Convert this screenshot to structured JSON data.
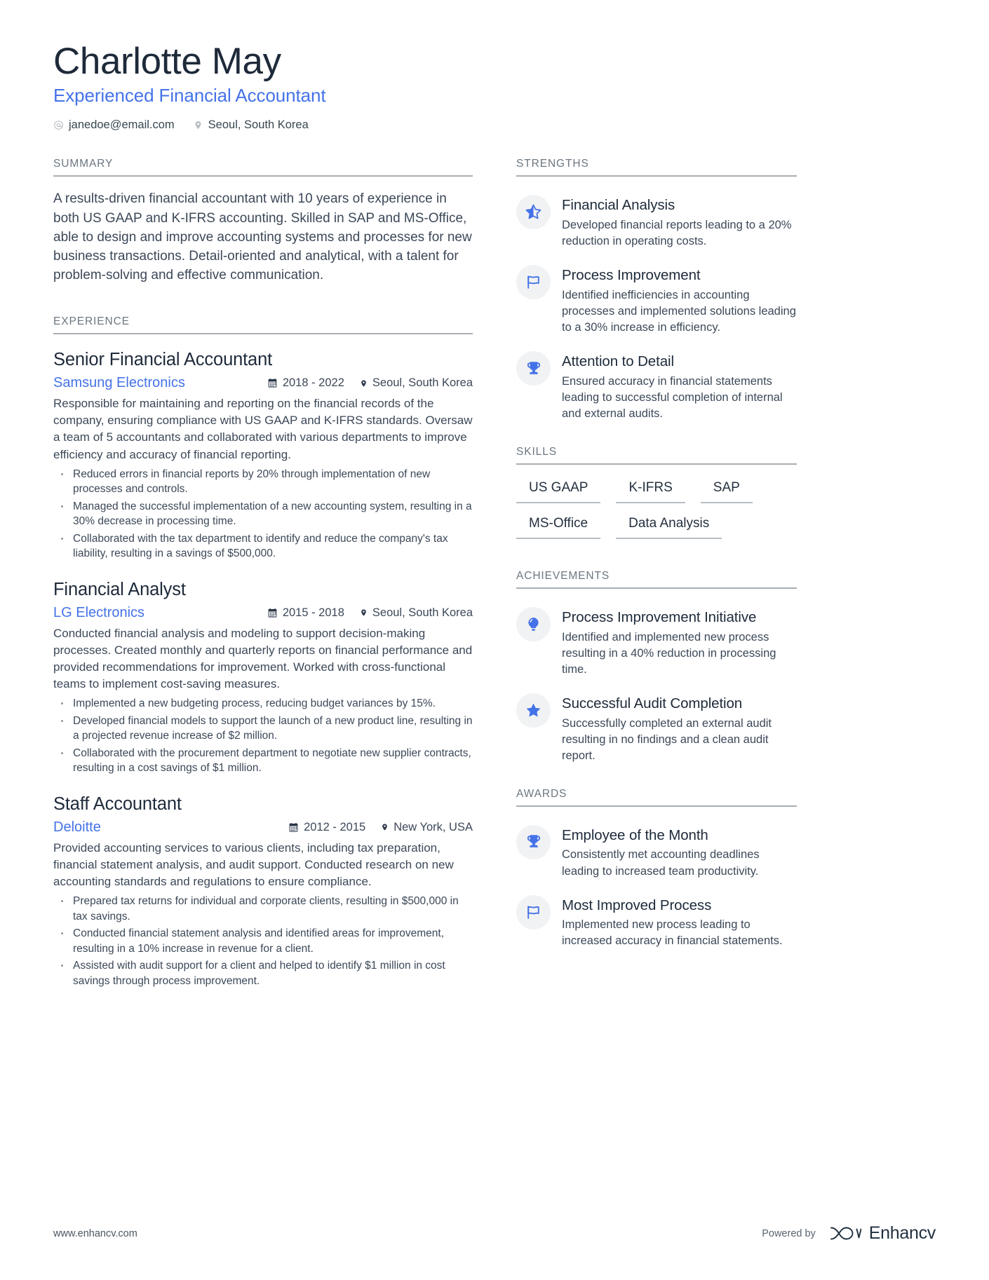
{
  "header": {
    "name": "Charlotte May",
    "role": "Experienced Financial Accountant",
    "contacts": [
      {
        "icon": "at-sign-icon",
        "text": "janedoe@email.com"
      },
      {
        "icon": "location-pin-icon",
        "text": "Seoul, South Korea"
      }
    ]
  },
  "sections": {
    "summary_title": "SUMMARY",
    "experience_title": "EXPERIENCE",
    "strengths_title": "STRENGTHS",
    "skills_title": "SKILLS",
    "achievements_title": "ACHIEVEMENTS",
    "awards_title": "AWARDS"
  },
  "summary": {
    "text": "A results-driven financial accountant with 10 years of experience in both US GAAP and K-IFRS accounting. Skilled in SAP and MS-Office, able to design and improve accounting systems and processes for new business transactions. Detail-oriented and analytical, with a talent for problem-solving and effective communication."
  },
  "experience": [
    {
      "title": "Senior Financial Accountant",
      "company": "Samsung Electronics",
      "dates": "2018 - 2022",
      "location": "Seoul, South Korea",
      "description": "Responsible for maintaining and reporting on the financial records of the company, ensuring compliance with US GAAP and K-IFRS standards. Oversaw a team of 5 accountants and collaborated with various departments to improve efficiency and accuracy of financial reporting.",
      "bullets": [
        "Reduced errors in financial reports by 20% through implementation of new processes and controls.",
        "Managed the successful implementation of a new accounting system, resulting in a 30% decrease in processing time.",
        "Collaborated with the tax department to identify and reduce the company's tax liability, resulting in a savings of $500,000."
      ]
    },
    {
      "title": "Financial Analyst",
      "company": "LG Electronics",
      "dates": "2015 - 2018",
      "location": "Seoul, South Korea",
      "description": "Conducted financial analysis and modeling to support decision-making processes. Created monthly and quarterly reports on financial performance and provided recommendations for improvement. Worked with cross-functional teams to implement cost-saving measures.",
      "bullets": [
        "Implemented a new budgeting process, reducing budget variances by 15%.",
        "Developed financial models to support the launch of a new product line, resulting in a projected revenue increase of $2 million.",
        "Collaborated with the procurement department to negotiate new supplier contracts, resulting in a cost savings of $1 million."
      ]
    },
    {
      "title": "Staff Accountant",
      "company": "Deloitte",
      "dates": "2012 - 2015",
      "location": "New York, USA",
      "description": "Provided accounting services to various clients, including tax preparation, financial statement analysis, and audit support. Conducted research on new accounting standards and regulations to ensure compliance.",
      "bullets": [
        "Prepared tax returns for individual and corporate clients, resulting in $500,000 in tax savings.",
        "Conducted financial statement analysis and identified areas for improvement, resulting in a 10% increase in revenue for a client.",
        "Assisted with audit support for a client and helped to identify $1 million in cost savings through process improvement."
      ]
    }
  ],
  "strengths": [
    {
      "icon": "half-star-icon",
      "title": "Financial Analysis",
      "description": "Developed financial reports leading to a 20% reduction in operating costs."
    },
    {
      "icon": "flag-outline-icon",
      "title": "Process Improvement",
      "description": "Identified inefficiencies in accounting processes and implemented solutions leading to a 30% increase in efficiency."
    },
    {
      "icon": "trophy-icon",
      "title": "Attention to Detail",
      "description": "Ensured accuracy in financial statements leading to successful completion of internal and external audits."
    }
  ],
  "skills": [
    "US GAAP",
    "K-IFRS",
    "SAP",
    "MS-Office",
    "Data Analysis"
  ],
  "achievements": [
    {
      "icon": "lightbulb-icon",
      "title": "Process Improvement Initiative",
      "description": "Identified and implemented new process resulting in a 40% reduction in processing time."
    },
    {
      "icon": "star-filled-icon",
      "title": "Successful Audit Completion",
      "description": "Successfully completed an external audit resulting in no findings and a clean audit report."
    }
  ],
  "awards": [
    {
      "icon": "trophy-icon",
      "title": "Employee of the Month",
      "description": "Consistently met accounting deadlines leading to increased team productivity."
    },
    {
      "icon": "flag-outline-icon",
      "title": "Most Improved Process",
      "description": "Implemented new process leading to increased accuracy in financial statements."
    }
  ],
  "footer": {
    "url": "www.enhancv.com",
    "powered_by": "Powered by",
    "brand": "Enhancv"
  },
  "colors": {
    "accent": "#4472e8",
    "heading": "#1e2a3a",
    "body": "#3c4858",
    "muted": "#6b7680",
    "rule": "#a8aeb4",
    "badge_bg": "#f1f2f3"
  }
}
